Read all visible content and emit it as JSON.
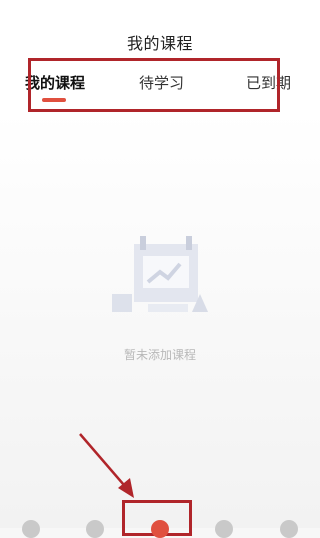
{
  "header": {
    "title": "我的课程"
  },
  "tabs": [
    {
      "label": "我的课程",
      "active": true
    },
    {
      "label": "待学习",
      "active": false
    },
    {
      "label": "已到期",
      "active": false
    }
  ],
  "empty_state": {
    "message": "暂未添加课程",
    "icon": "empty-calendar-chart-icon"
  },
  "bottom_nav": {
    "active_index": 2,
    "item_count": 5
  },
  "colors": {
    "accent": "#e0503f",
    "annotation": "#b0252a",
    "muted_text": "#b8b8b8"
  }
}
